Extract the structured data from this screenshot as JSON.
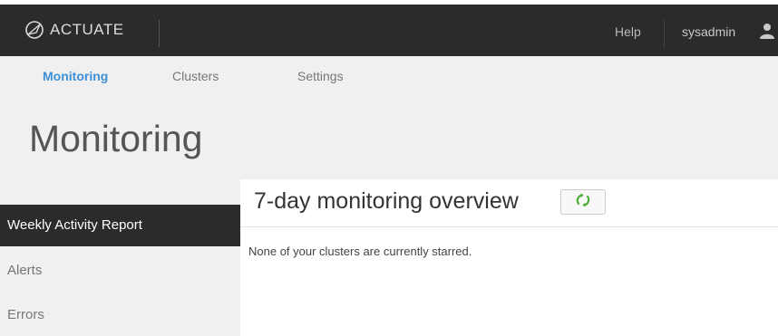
{
  "topbar": {
    "logo_text": "ACTUATE",
    "help_label": "Help",
    "username": "sysadmin"
  },
  "nav": {
    "tabs": [
      {
        "label": "Monitoring",
        "active": true
      },
      {
        "label": "Clusters",
        "active": false
      },
      {
        "label": "Settings",
        "active": false
      }
    ]
  },
  "page": {
    "title": "Monitoring"
  },
  "sidebar": {
    "items": [
      {
        "label": "Weekly Activity Report",
        "active": true
      },
      {
        "label": "Alerts",
        "active": false
      },
      {
        "label": "Errors",
        "active": false
      }
    ]
  },
  "main": {
    "section_title": "7-day monitoring overview",
    "empty_message": "None of your clusters are currently starred."
  },
  "icons": {
    "logo": "actuate-logo-icon",
    "user": "user-icon",
    "refresh": "refresh-icon"
  },
  "colors": {
    "topbar_bg": "#2b2b2b",
    "header_bg": "#f0f0f0",
    "active_tab": "#3d8fd6",
    "active_sidebar_bg": "#2b2b2b",
    "refresh_icon": "#4caf3a"
  }
}
